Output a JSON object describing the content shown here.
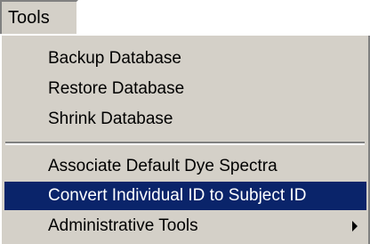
{
  "menu": {
    "title": "Tools",
    "items": [
      {
        "label": "Backup Database"
      },
      {
        "label": "Restore Database"
      },
      {
        "label": "Shrink Database"
      },
      {
        "label": "Associate Default Dye Spectra"
      },
      {
        "label": "Convert Individual ID to Subject ID"
      },
      {
        "label": "Administrative Tools"
      }
    ],
    "selected_index": 4,
    "submenu_arrow_icon": "triangle-right"
  },
  "colors": {
    "menu_background": "#d4d0c8",
    "highlight_background": "#0a246a",
    "highlight_text": "#ffffff",
    "text": "#000000"
  }
}
